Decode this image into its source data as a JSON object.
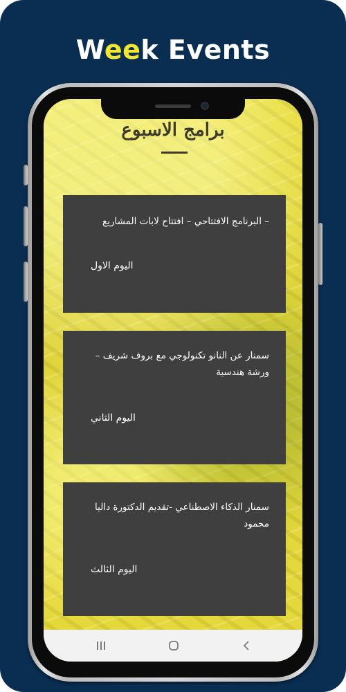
{
  "promo": {
    "title_part1": "W",
    "title_highlight": "ee",
    "title_part2": "k Events"
  },
  "screen": {
    "heading": "برامج الاسبوع",
    "cards": [
      {
        "title": "– البرنامج الافتتاحي – افتتاح لابات المشاريع",
        "day": "اليوم الاول"
      },
      {
        "title": "سمنار عن النانو تكنولوجي مع بروف شريف – ورشة هندسية",
        "day": "اليوم الثاني"
      },
      {
        "title": "سمنار الذكاء الاصطناعي -تقديم الدكتورة داليا محمود",
        "day": "اليوم الثالث"
      }
    ]
  },
  "navbar": {
    "icons": [
      "recent-apps-icon",
      "home-icon",
      "back-icon"
    ]
  },
  "colors": {
    "background": "#0a2e52",
    "accent": "#f2e62e",
    "card": "#3f3f3f",
    "screen_yellow": "#e9dd3c"
  }
}
